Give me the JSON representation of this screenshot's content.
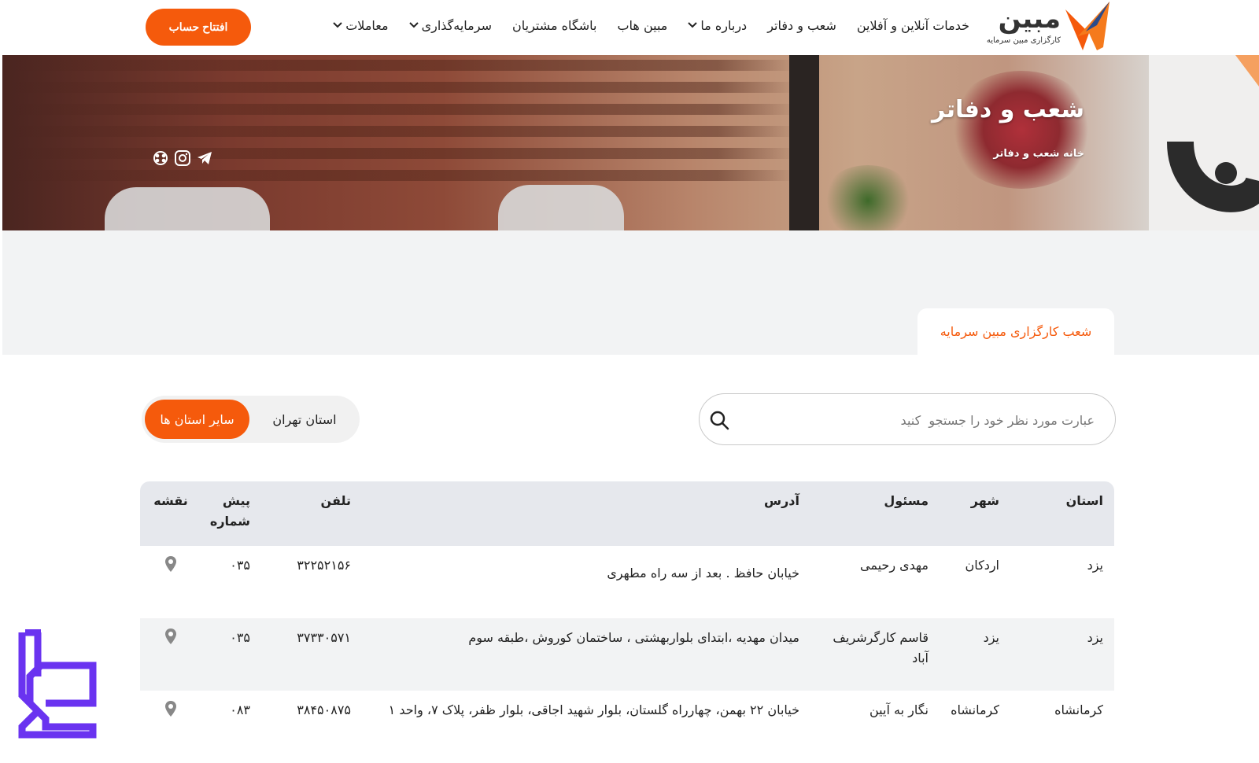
{
  "header": {
    "logo_text": "مبین",
    "logo_subtitle": "کارگزاری مبین سرمایه",
    "nav": [
      {
        "label": "معاملات",
        "dropdown": true
      },
      {
        "label": "سرمایه‌گذاری",
        "dropdown": true
      },
      {
        "label": "باشگاه مشتریان",
        "dropdown": false
      },
      {
        "label": "مبین هاب",
        "dropdown": false
      },
      {
        "label": "درباره ما",
        "dropdown": true
      },
      {
        "label": "شعب و دفاتر",
        "dropdown": false
      },
      {
        "label": "خدمات آنلاین و آفلاین",
        "dropdown": false
      }
    ],
    "cta": "افتتاح حساب"
  },
  "hero": {
    "title": "شعب و دفاتر",
    "breadcrumb": "خانه شعب و دفاتر",
    "socials": [
      "telegram-icon",
      "instagram-icon",
      "aparat-icon"
    ]
  },
  "tab": {
    "label": "شعب کارگزاری مبین سرمایه"
  },
  "search": {
    "placeholder": "عبارت مورد نظر خود را جستجو  کنید"
  },
  "toggle": {
    "active": "سایر استان ها",
    "other": "استان تهران"
  },
  "table": {
    "headers": {
      "ostan": "استان",
      "shahr": "شهر",
      "masool": "مسئول",
      "address": "آدرس",
      "tel": "تلفن",
      "pish": "پیش شماره",
      "map": "نقشه"
    },
    "rows": [
      {
        "ostan": "یزد",
        "shahr": "اردکان",
        "masool": "مهدی رحیمی",
        "address": "خیابان حافظ . بعد از سه راه مطهری",
        "tel": "۳۲۲۵۲۱۵۶",
        "pish": "۰۳۵"
      },
      {
        "ostan": "یزد",
        "shahr": "یزد",
        "masool": "قاسم کارگرشریف آباد",
        "address": "میدان مهدیه ،ابتدای بلواربهشتی ، ساختمان کوروش ،طبقه سوم",
        "tel": "۳۷۳۳۰۵۷۱",
        "pish": "۰۳۵"
      },
      {
        "ostan": "کرمانشاه",
        "shahr": "کرمانشاه",
        "masool": "نگار به آیین",
        "address": "خیابان ۲۲ بهمن، چهارراه گلستان، بلوار شهید اجاقی، بلوار ظفر، پلاک ۷، واحد ۱",
        "tel": "۳۸۴۵۰۸۷۵",
        "pish": "۰۸۳"
      }
    ]
  },
  "colors": {
    "accent": "#f55a0c",
    "band": "#f2f3f4",
    "thead": "#e6e8ed"
  }
}
